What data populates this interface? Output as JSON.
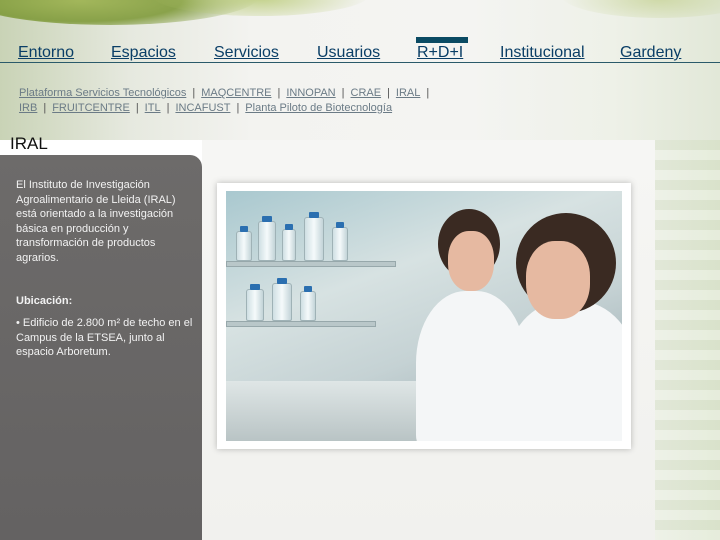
{
  "nav": {
    "items": [
      {
        "label": "Entorno"
      },
      {
        "label": "Espacios"
      },
      {
        "label": "Servicios"
      },
      {
        "label": "Usuarios"
      },
      {
        "label": "R+D+I",
        "active": true
      },
      {
        "label": "Institucional"
      },
      {
        "label": "Gardeny"
      }
    ]
  },
  "sublinks": {
    "row1": [
      "Plataforma Servicios Tecnológicos",
      "MAQCENTRE",
      "INNOPAN",
      "CRAE",
      "IRAL"
    ],
    "row2": [
      "IRB",
      "FRUITCENTRE",
      "ITL",
      "INCAFUST",
      "Planta Piloto de Biotecnología"
    ],
    "separator": "|"
  },
  "page": {
    "title": "IRAL"
  },
  "sidebar": {
    "intro": "El Instituto de Investigación Agroalimentario de Lleida (IRAL) está orientado a la investigación básica en producción y transformación de productos agrarios.",
    "location_title": "Ubicación:",
    "location_body": "• Edificio de 2.800 m² de techo en el Campus de la ETSEA, junto al espacio Arboretum."
  },
  "colors": {
    "nav_link": "#0a3e66",
    "active_marker": "#0a4a63",
    "sublink": "#6b7b86",
    "sidebar_bg": "#6d6b6a"
  }
}
